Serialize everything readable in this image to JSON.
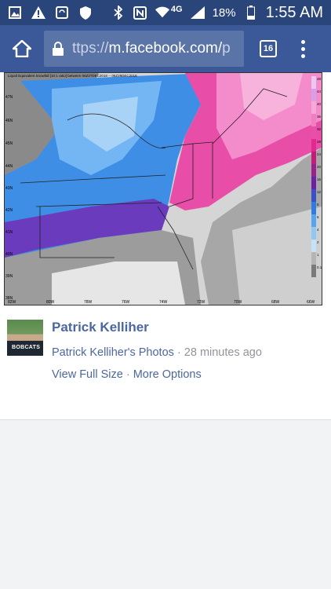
{
  "status_bar": {
    "battery_text": "18%",
    "time": "1:55 AM",
    "network": "4G",
    "left_icons": [
      "gallery-icon",
      "warning-icon",
      "sync-icon",
      "shield-icon"
    ],
    "right_icons": [
      "bluetooth-icon",
      "nfc-icon",
      "wifi-icon",
      "signal-icon",
      "battery-icon"
    ]
  },
  "browser": {
    "url_prefix": "ttps://",
    "url_main": "m.facebook.com/",
    "url_tail": "p",
    "tab_count": "16"
  },
  "map": {
    "header_text": "Liquid Equivalent Snowfall [10:1 ratio] between 06Z27DEC2018 -- 06Z29DEC2018",
    "lat_labels": [
      "47N",
      "46N",
      "45N",
      "44N",
      "43N",
      "42N",
      "41N",
      "40N",
      "39N",
      "38N"
    ],
    "lon_labels": [
      "82W",
      "80W",
      "78W",
      "76W",
      "74W",
      "72W",
      "70W",
      "68W",
      "66W"
    ],
    "scale_labels": [
      "48",
      "44",
      "40",
      "36",
      "32",
      "28",
      "24",
      "20",
      "16",
      "12",
      "8",
      "6",
      "4",
      "2",
      "1",
      "0.1"
    ],
    "scale_colors": [
      "#e9c8f2",
      "#d7a0e6",
      "#f7a8d7",
      "#f07ec0",
      "#ea4fa7",
      "#e12a8d",
      "#c81a78",
      "#9c1f8f",
      "#6f21a6",
      "#3b4fc9",
      "#2d7be3",
      "#55a5f2",
      "#8fc7f7",
      "#c6e2fb",
      "#b5b5b5",
      "#7a7a7a"
    ]
  },
  "post": {
    "author": "Patrick Kelliher",
    "avatar_text": "BOBCATS",
    "album_link": "Patrick Kelliher's Photos",
    "separator": " · ",
    "time_ago": "28 minutes ago",
    "view_full_size": "View Full Size",
    "more_options": "More Options"
  }
}
